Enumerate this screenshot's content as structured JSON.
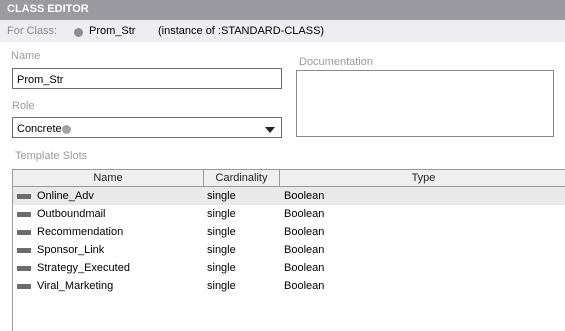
{
  "window": {
    "title": "CLASS EDITOR"
  },
  "for_class": {
    "label": "For Class:",
    "class_name": "Prom_Str",
    "instance_text": "(instance of :STANDARD-CLASS)"
  },
  "form": {
    "name_label": "Name",
    "name_value": "Prom_Str",
    "documentation_label": "Documentation",
    "documentation_value": "",
    "role_label": "Role",
    "role_value": "Concrete"
  },
  "template_slots": {
    "label": "Template Slots",
    "columns": [
      "Name",
      "Cardinality",
      "Type"
    ],
    "rows": [
      {
        "name": "Online_Adv",
        "cardinality": "single",
        "type": "Boolean"
      },
      {
        "name": "Outboundmail",
        "cardinality": "single",
        "type": "Boolean"
      },
      {
        "name": "Recommendation",
        "cardinality": "single",
        "type": "Boolean"
      },
      {
        "name": "Sponsor_Link",
        "cardinality": "single",
        "type": "Boolean"
      },
      {
        "name": "Strategy_Executed",
        "cardinality": "single",
        "type": "Boolean"
      },
      {
        "name": "Viral_Marketing",
        "cardinality": "single",
        "type": "Boolean"
      }
    ]
  },
  "colors": {
    "title_bar": "#9a9aa0",
    "selected_row": "#e9e9ea",
    "slot_swatch": "#6b6b6b"
  },
  "icons": {
    "class_indicator": "circle-icon",
    "slot_indicator": "slot-bar-icon",
    "dropdown": "chevron-down-icon"
  }
}
